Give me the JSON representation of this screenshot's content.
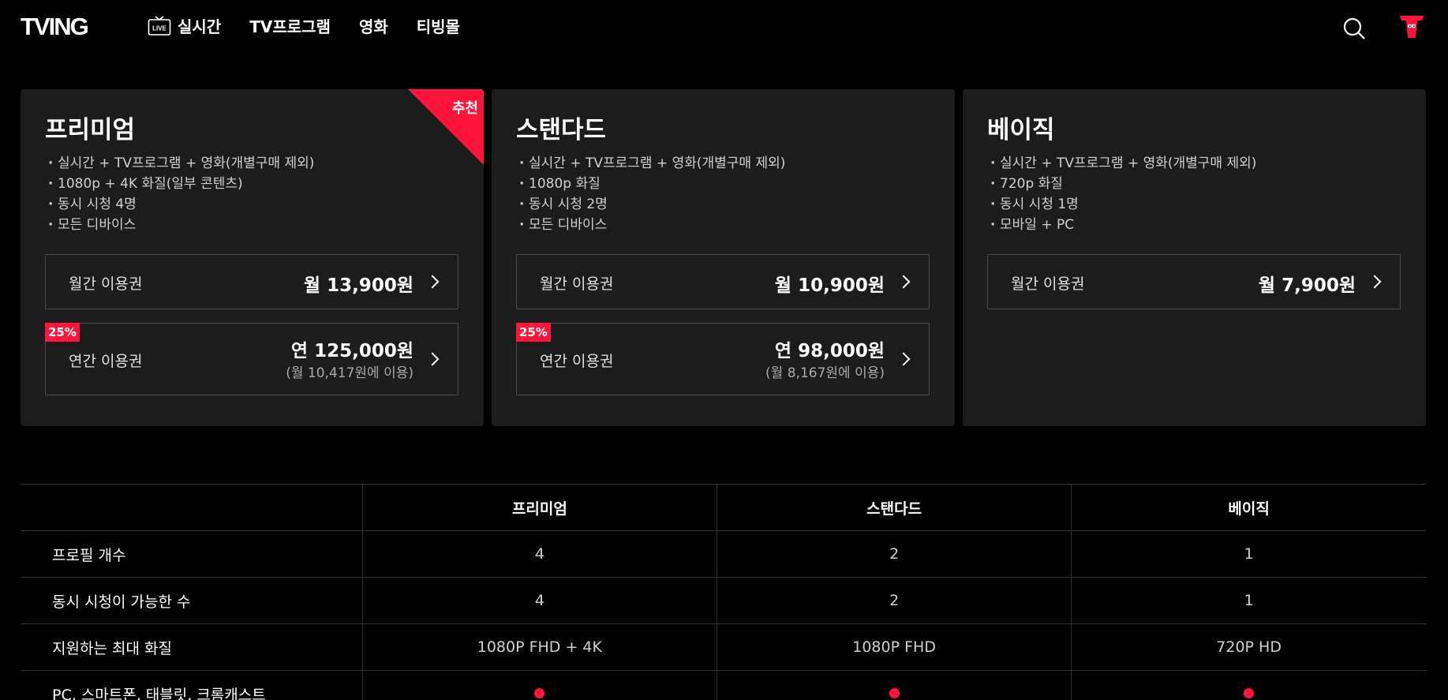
{
  "header": {
    "logo": "TVING",
    "nav": [
      {
        "label": "실시간",
        "icon": "live-tv-icon",
        "icon_text": "LIVE"
      },
      {
        "label": "TV프로그램"
      },
      {
        "label": "영화"
      },
      {
        "label": "티빙몰"
      }
    ],
    "search_icon": "search-icon",
    "profile_icon": "profile-icon"
  },
  "accent_color": "#ff153c",
  "plans": [
    {
      "name": "프리미엄",
      "recommended": "추천",
      "features": [
        "실시간 + TV프로그램 + 영화(개별구매 제외)",
        "1080p + 4K 화질(일부 콘텐츠)",
        "동시 시청 4명",
        "모든 디바이스"
      ],
      "monthly": {
        "label": "월간 이용권",
        "price": "월 13,900원"
      },
      "yearly": {
        "badge": "25%",
        "label": "연간 이용권",
        "price": "연 125,000원",
        "sub": "(월 10,417원에 이용)"
      }
    },
    {
      "name": "스탠다드",
      "features": [
        "실시간 + TV프로그램 + 영화(개별구매 제외)",
        "1080p 화질",
        "동시 시청 2명",
        "모든 디바이스"
      ],
      "monthly": {
        "label": "월간 이용권",
        "price": "월 10,900원"
      },
      "yearly": {
        "badge": "25%",
        "label": "연간 이용권",
        "price": "연 98,000원",
        "sub": "(월 8,167원에 이용)"
      }
    },
    {
      "name": "베이직",
      "features": [
        "실시간 + TV프로그램 + 영화(개별구매 제외)",
        "720p 화질",
        "동시 시청 1명",
        "모바일 + PC"
      ],
      "monthly": {
        "label": "월간 이용권",
        "price": "월 7,900원"
      }
    }
  ],
  "compare": {
    "headers": [
      "",
      "프리미엄",
      "스탠다드",
      "베이직"
    ],
    "rows": [
      {
        "label": "프로필 개수",
        "values": [
          "4",
          "2",
          "1"
        ]
      },
      {
        "label": "동시 시청이 가능한 수",
        "values": [
          "4",
          "2",
          "1"
        ]
      },
      {
        "label": "지원하는 최대 화질",
        "values": [
          "1080P FHD + 4K",
          "1080P FHD",
          "720P HD"
        ]
      },
      {
        "label": "PC, 스마트폰, 태블릿, 크롬캐스트",
        "values": [
          "included",
          "included",
          "included"
        ]
      }
    ]
  }
}
